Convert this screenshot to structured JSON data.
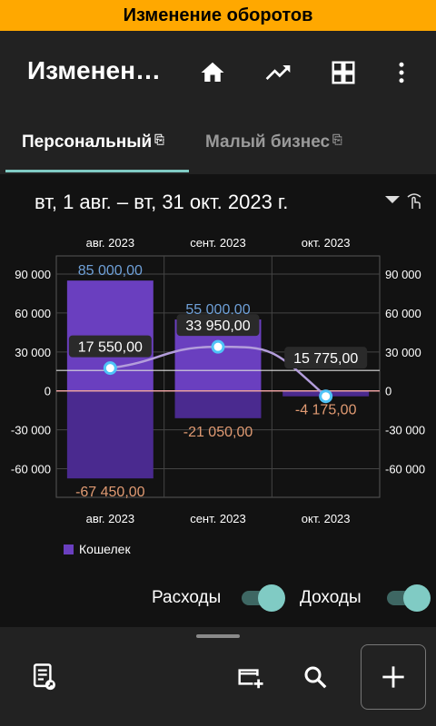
{
  "banner": {
    "title": "Изменение оборотов"
  },
  "appbar": {
    "title": "Изменение оборотов",
    "icons": [
      "home-icon",
      "trending-up-icon",
      "dashboard-icon",
      "more-vert-icon"
    ]
  },
  "tabs": [
    {
      "label": "Персональный",
      "active": true
    },
    {
      "label": "Малый бизнес",
      "active": false
    }
  ],
  "date_range": {
    "label": "вт, 1 авг. – вт, 31 окт. 2023 г."
  },
  "chart_data": {
    "type": "bar",
    "categories": [
      "авг. 2023",
      "сент. 2023",
      "окт. 2023"
    ],
    "series": [
      {
        "name": "Кошелек",
        "kind": "income",
        "values": [
          85000,
          55000,
          0
        ],
        "labels": [
          "85 000,00",
          "55 000,00",
          ""
        ]
      },
      {
        "name": "Кошелек",
        "kind": "expense",
        "values": [
          -67450,
          -21050,
          -4175
        ],
        "labels": [
          "-67 450,00",
          "-21 050,00",
          "-4 175,00"
        ]
      },
      {
        "name": "balance",
        "kind": "line",
        "values": [
          17550,
          33950,
          -4175
        ],
        "labels": [
          "17 550,00",
          "33 950,00",
          ""
        ]
      }
    ],
    "average": {
      "value": 15775,
      "label": "15 775,00"
    },
    "y_ticks": [
      "90 000",
      "60 000",
      "30 000",
      "0",
      "-30 000",
      "-60 000"
    ],
    "y_tick_values": [
      90000,
      60000,
      30000,
      0,
      -30000,
      -60000
    ],
    "ylim": [
      -82000,
      104000
    ],
    "grid": true,
    "colors": {
      "income": "#6a3fbf",
      "expense": "#4a2a8f",
      "line": "#b39ddb",
      "income_label": "#6fa0d8",
      "expense_label": "#e09a72",
      "zero": "#e8a0a0"
    },
    "legend": [
      {
        "label": "Кошелек",
        "color": "#6a3fbf"
      }
    ]
  },
  "toggles": {
    "expenses_label": "Расходы",
    "income_label": "Доходы"
  },
  "bottombar": {
    "icons": [
      "report-icon",
      "add-window-icon",
      "search-icon",
      "add-icon"
    ]
  }
}
